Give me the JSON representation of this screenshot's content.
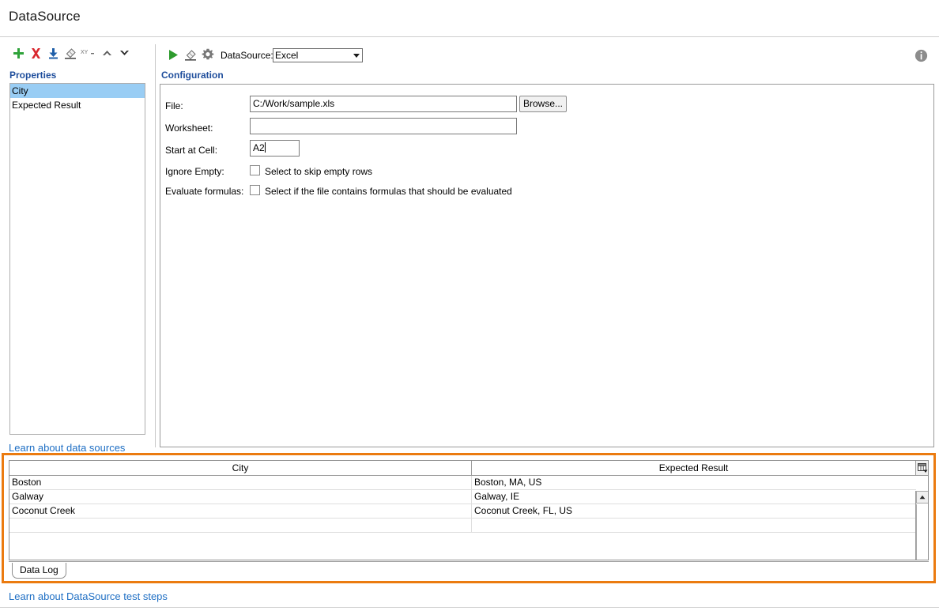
{
  "window": {
    "title": "DataSource"
  },
  "left_pane": {
    "toolbar": [
      {
        "name": "add-property-button",
        "icon": "plus-icon",
        "tooltip": "Add"
      },
      {
        "name": "delete-property-button",
        "icon": "x-icon",
        "tooltip": "Delete"
      },
      {
        "name": "import-properties-button",
        "icon": "import-icon",
        "tooltip": "Import"
      },
      {
        "name": "clear-properties-button",
        "icon": "eraser-icon",
        "tooltip": "Clear"
      },
      {
        "name": "rename-property-button",
        "icon": "xy-icon",
        "label": "xy",
        "tooltip": "Rename"
      },
      {
        "name": "move-up-button",
        "icon": "chevron-up-icon",
        "tooltip": "Move Up"
      },
      {
        "name": "move-down-button",
        "icon": "chevron-down-icon",
        "tooltip": "Move Down"
      }
    ],
    "properties_label": "Properties",
    "properties": [
      {
        "label": "City",
        "selected": true
      },
      {
        "label": "Expected Result",
        "selected": false
      }
    ],
    "learn_link": "Learn about data sources"
  },
  "right_pane": {
    "toolbar": [
      {
        "name": "run-button",
        "icon": "play-icon",
        "tooltip": "Run"
      },
      {
        "name": "clear-data-button",
        "icon": "eraser-icon",
        "tooltip": "Clear"
      },
      {
        "name": "options-button",
        "icon": "gear-icon",
        "tooltip": "Options"
      }
    ],
    "datasource_label": "DataSource:",
    "datasource_value": "Excel",
    "datasource_options": [
      "Excel"
    ],
    "configuration_label": "Configuration",
    "info_icon": "info-icon",
    "fields": {
      "file": {
        "label": "File:",
        "value": "C:/Work/sample.xls",
        "placeholder": "",
        "browse_label": "Browse..."
      },
      "worksheet": {
        "label": "Worksheet:",
        "value": "",
        "placeholder": ""
      },
      "start_at_cell": {
        "label": "Start at Cell:",
        "value": "A2",
        "placeholder": "",
        "has_caret": true
      },
      "ignore_empty": {
        "label": "Ignore Empty:",
        "checkbox_label": "Select to skip empty rows",
        "checked": false
      },
      "evaluate_formulas": {
        "label": "Evaluate formulas:",
        "checkbox_label": "Select if the file contains formulas that should be evaluated",
        "checked": false
      }
    }
  },
  "data_grid": {
    "columns": [
      "City",
      "Expected Result"
    ],
    "rows": [
      [
        "Boston",
        "Boston, MA, US"
      ],
      [
        "Galway",
        "Galway, IE"
      ],
      [
        "Coconut Creek",
        "Coconut Creek, FL, US"
      ]
    ],
    "column_chooser_icon": "grid-columns-icon",
    "scroll_up_icon": "scroll-up-icon",
    "scroll_down_icon": "scroll-down-icon"
  },
  "bottom": {
    "tabs": [
      {
        "label": "Data Log",
        "active": true
      }
    ],
    "learn_link": "Learn about DataSource test steps"
  },
  "colors": {
    "highlight_border": "#eb7b10",
    "link": "#1f6fc4",
    "section_heading": "#1f4e9c",
    "selection": "#99cdf4",
    "play_green": "#2e9b2e",
    "delete_red": "#d9272e",
    "import_blue": "#1f5fa9"
  }
}
